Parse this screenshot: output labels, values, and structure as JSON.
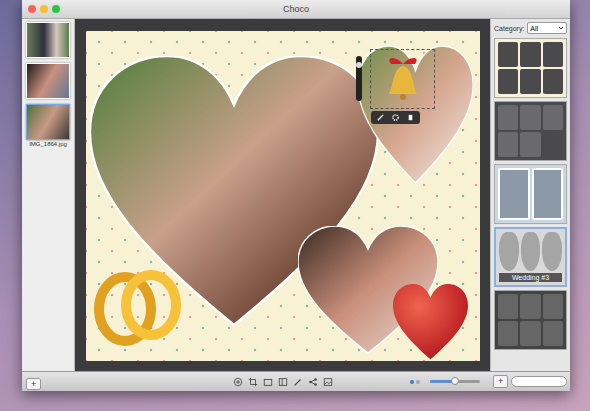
{
  "window": {
    "title": "Choco",
    "controls": [
      {
        "name": "close",
        "color": "#fc5f57"
      },
      {
        "name": "minimize",
        "color": "#fdbc2e"
      },
      {
        "name": "zoom",
        "color": "#2ac840"
      }
    ]
  },
  "photos": [
    {
      "selected": false
    },
    {
      "selected": false
    },
    {
      "label": "IMG_1864.jpg",
      "selected": true
    }
  ],
  "category": {
    "label": "Category:",
    "value": "All"
  },
  "templates": [
    {
      "kind": "collage",
      "selected": false
    },
    {
      "kind": "mosaic",
      "selected": false
    },
    {
      "kind": "frame",
      "selected": false
    },
    {
      "kind": "wedding",
      "label": "Wedding #3",
      "selected": true
    },
    {
      "kind": "grid",
      "selected": false
    }
  ],
  "toolbar": {
    "pages": [
      {
        "selected": true
      },
      {
        "selected": false
      }
    ],
    "zoom": {
      "level": 0.5
    }
  },
  "sidebar_footer": {
    "add": "+"
  },
  "templates_footer": {
    "add": "+",
    "search": {
      "placeholder": ""
    }
  }
}
